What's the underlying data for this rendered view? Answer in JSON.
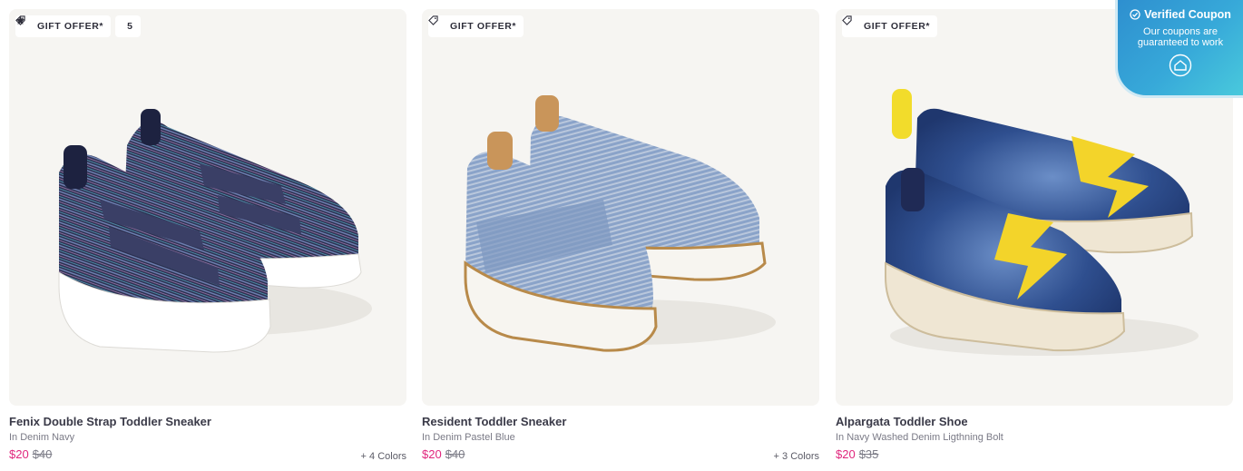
{
  "verified_badge": {
    "title": "Verified Coupon",
    "text": "Our coupons are guaranteed to work",
    "check_icon": "check-circle-icon",
    "emblem_icon": "shield-home-icon"
  },
  "colors": {
    "sale_price": "#e0267d",
    "card_bg": "#f6f5f2",
    "badge_gradient_start": "#2e8fcf",
    "badge_gradient_end": "#49c9dc"
  },
  "products": [
    {
      "gift_label": "GIFT OFFER*",
      "rating": "5",
      "rating_icon": "star-icon",
      "name": "Fenix Double Strap Toddler Sneaker",
      "variant": "In Denim Navy",
      "price": "$20",
      "original_price": "$40",
      "colors_count": "+ 4 Colors"
    },
    {
      "gift_label": "GIFT OFFER*",
      "name": "Resident Toddler Sneaker",
      "variant": "In Denim Pastel Blue",
      "price": "$20",
      "original_price": "$40",
      "colors_count": "+ 3 Colors"
    },
    {
      "gift_label": "GIFT OFFER*",
      "name": "Alpargata Toddler Shoe",
      "variant": "In Navy Washed Denim Ligthning Bolt",
      "price": "$20",
      "original_price": "$35",
      "colors_count": ""
    }
  ]
}
